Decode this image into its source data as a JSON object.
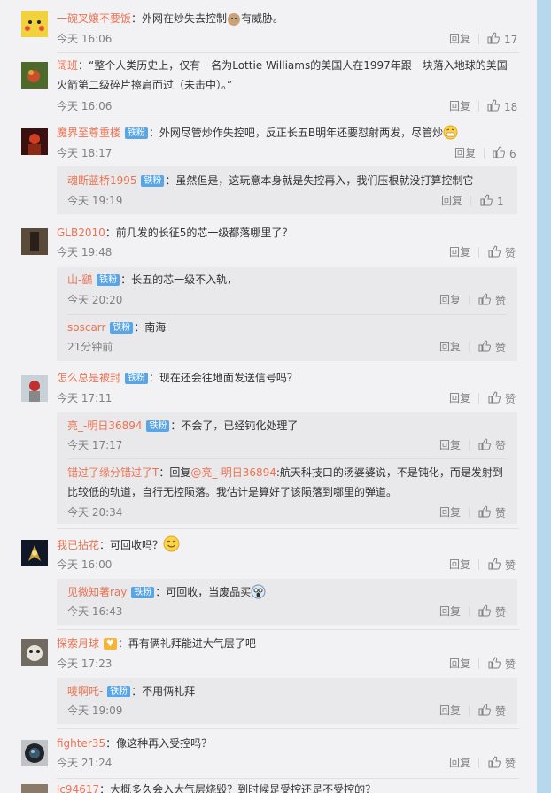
{
  "reply_label": "回复",
  "colors": {
    "username": "#eb7350",
    "badge": "#5aa5e6",
    "meta": "#808080",
    "text": "#333333"
  },
  "badge_label": "铁粉",
  "comments": [
    {
      "user": "一碗叉嬢不要饭",
      "text": "：外网在炒失去控制",
      "text2": "有威胁。",
      "time": "今天 16:06",
      "likes": "17"
    },
    {
      "user": "阔班",
      "text": "：“整个人类历史上，仅有一名为Lottie Williams的美国人在1997年跟一块落入地球的美国火箭第二级碎片擦肩而过（未击中）。”",
      "time": "今天 16:06",
      "likes": "18"
    },
    {
      "user": "魔界至尊重楼",
      "text": "：外网尽管炒作失控吧，反正长五B明年还要怼射两发，尽管炒",
      "time": "今天 18:17",
      "likes": "6",
      "replies": [
        {
          "user": "魂断蓝桥1995",
          "text": "：虽然但是，这玩意本身就是失控再入，我们压根就没打算控制它",
          "time": "今天 19:19",
          "likes": "1"
        }
      ]
    },
    {
      "user": "GLB2010",
      "text": "：前几发的长征5的芯一级都落哪里了？",
      "time": "今天 19:48",
      "likes": "赞",
      "replies": [
        {
          "user": "山-鷂",
          "text": "：长五的芯一级不入轨，",
          "time": "今天 20:20",
          "likes": "赞"
        },
        {
          "user": "soscarr",
          "text": "：南海",
          "time": "21分钟前",
          "likes": "赞"
        }
      ]
    },
    {
      "user": "怎么总是被封",
      "text": "：现在还会往地面发送信号吗？",
      "time": "今天 17:11",
      "likes": "赞",
      "replies": [
        {
          "user": "亮_-明日36894",
          "text": "：不会了，已经钝化处理了",
          "time": "今天 17:17",
          "likes": "赞"
        },
        {
          "user": "错过了缘分错过了T",
          "text": "：回复",
          "mention": "@亮_-明日36894",
          "text2": ":航天科技口的汤婆婆说，不是钝化，而是发射到比较低的轨道，自行无控陨落。我估计是算好了该陨落到哪里的弹道。",
          "time": "今天 20:34",
          "likes": "赞"
        }
      ]
    },
    {
      "user": "我已拈花",
      "text": "：可回收吗？",
      "time": "今天 16:00",
      "likes": "赞",
      "replies": [
        {
          "user": "见微知著ray",
          "text": "：可回收，当废品买",
          "time": "今天 16:43",
          "likes": "赞"
        }
      ]
    },
    {
      "user": "探索月球",
      "text": "：再有俩礼拜能进大气层了吧",
      "time": "今天 17:23",
      "likes": "赞",
      "replies": [
        {
          "user": "唛啊吒-",
          "text": "：不用俩礼拜",
          "time": "今天 19:09",
          "likes": "赞"
        }
      ]
    },
    {
      "user": "fighter35",
      "text": "：像这种再入受控吗？",
      "time": "今天 21:24",
      "likes": "赞"
    },
    {
      "user": "lc94617",
      "text": "：大概多久会入大气层烧毁？到时候是受控还是不受控的？",
      "time": "",
      "likes": ""
    }
  ]
}
